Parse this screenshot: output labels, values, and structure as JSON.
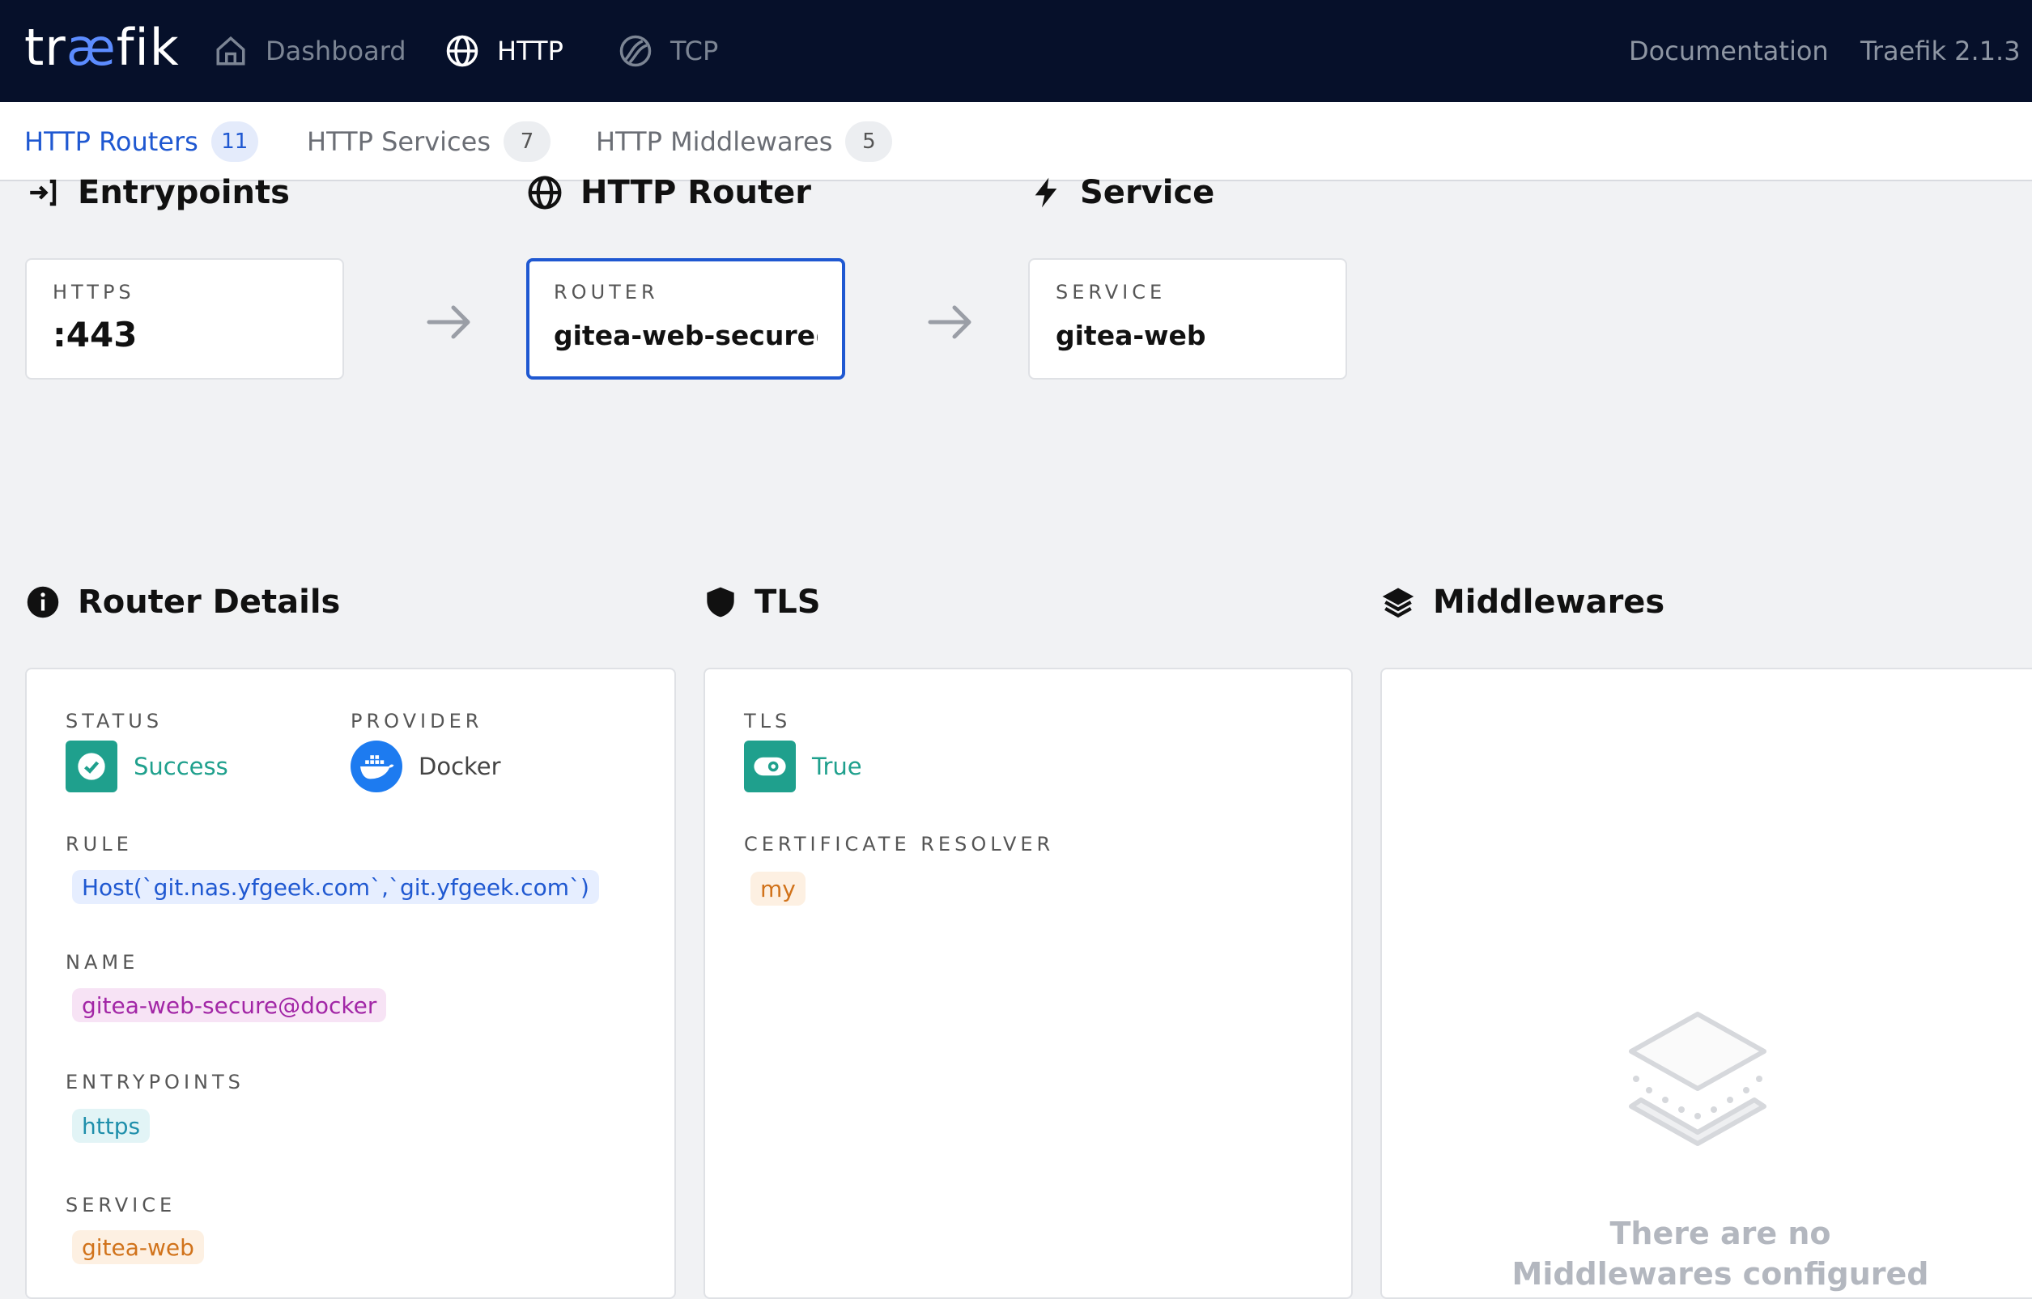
{
  "nav": {
    "brand_pre": "tr",
    "brand_ae": "æ",
    "brand_post": "fik",
    "items": [
      {
        "label": "Dashboard",
        "icon": "home-icon"
      },
      {
        "label": "HTTP",
        "icon": "globe-icon",
        "active": true
      },
      {
        "label": "TCP",
        "icon": "tcp-icon"
      }
    ],
    "documentation": "Documentation",
    "version": "Traefik 2.1.3"
  },
  "subtabs": [
    {
      "label": "HTTP Routers",
      "count": "11",
      "active": true
    },
    {
      "label": "HTTP Services",
      "count": "7"
    },
    {
      "label": "HTTP Middlewares",
      "count": "5"
    }
  ],
  "flow": {
    "entrypoints_heading": "Entrypoints",
    "router_heading": "HTTP Router",
    "service_heading": "Service",
    "entrypoint": {
      "label": "HTTPS",
      "value": ":443"
    },
    "router": {
      "label": "ROUTER",
      "value": "gitea-web-secure@..."
    },
    "service": {
      "label": "SERVICE",
      "value": "gitea-web"
    }
  },
  "details": {
    "heading": "Router Details",
    "status_label": "STATUS",
    "status_value": "Success",
    "provider_label": "PROVIDER",
    "provider_value": "Docker",
    "rule_label": "RULE",
    "rule_value": "Host(`git.nas.yfgeek.com`,`git.yfgeek.com`)",
    "name_label": "NAME",
    "name_value": "gitea-web-secure@docker",
    "entrypoints_label": "ENTRYPOINTS",
    "entrypoints_value": "https",
    "service_label": "SERVICE",
    "service_value": "gitea-web"
  },
  "tls": {
    "heading": "TLS",
    "tls_label": "TLS",
    "tls_value": "True",
    "resolver_label": "CERTIFICATE RESOLVER",
    "resolver_value": "my"
  },
  "middlewares": {
    "heading": "Middlewares",
    "empty_line1": "There are no",
    "empty_line2": "Middlewares configured"
  },
  "colors": {
    "navbar_bg": "#06102a",
    "accent_blue": "#1f58d1",
    "success_green": "#1fa08d",
    "docker_blue": "#1d7bf0"
  }
}
